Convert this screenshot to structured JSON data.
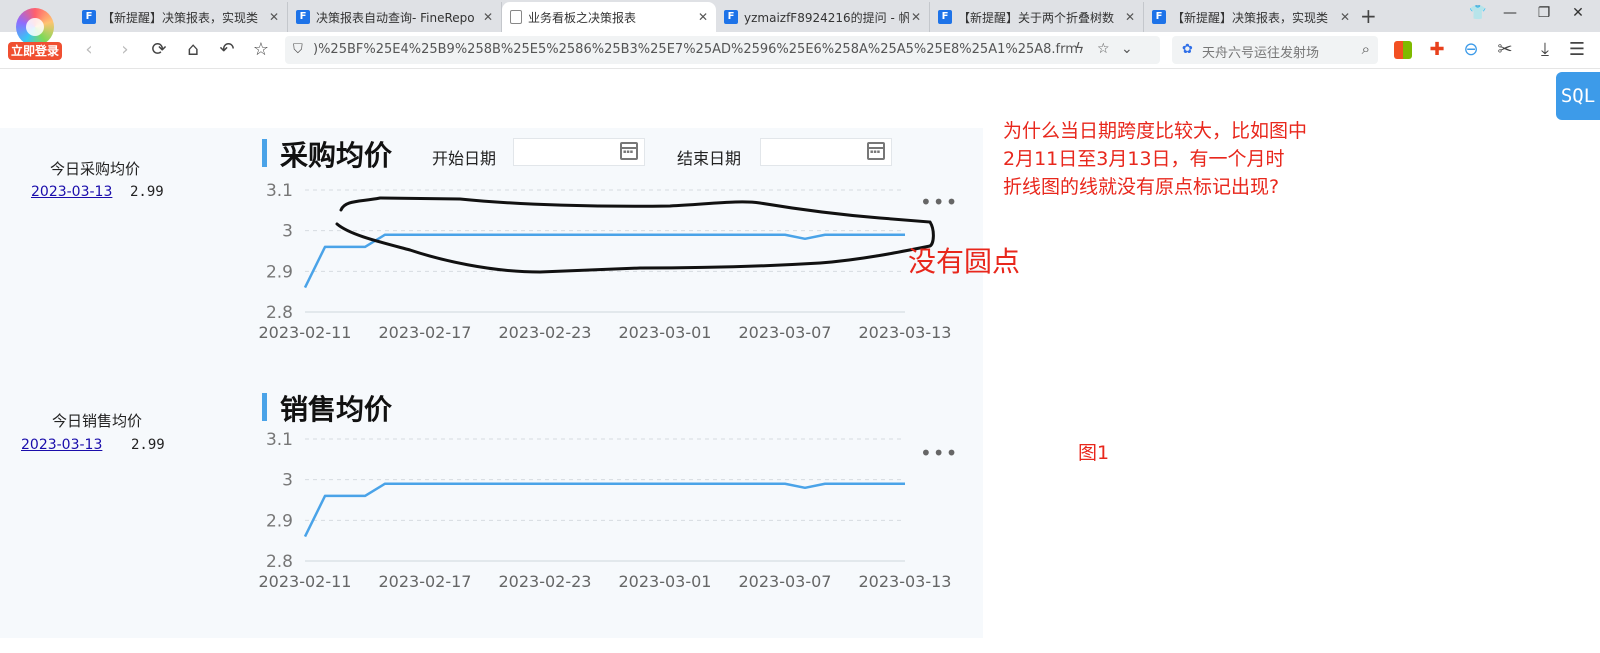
{
  "browser": {
    "login_label": "立即登录",
    "tabs": [
      {
        "title": "【新提醒】决策报表，实现类",
        "active": false
      },
      {
        "title": "决策报表自动查询- FineRepo",
        "active": false
      },
      {
        "title": "业务看板之决策报表",
        "active": true
      },
      {
        "title": "yzmaizfF8924216的提问 - 帆",
        "active": false
      },
      {
        "title": "【新提醒】关于两个折叠树数",
        "active": false
      },
      {
        "title": "【新提醒】决策报表，实现类",
        "active": false
      }
    ],
    "url": ")%25BF%25E4%25B9%258B%25E5%2586%25B3%25E7%25AD%2596%25E6%258A%25A5%25E8%25A1%25A8.frm",
    "search_placeholder": "天舟六号运往发射场"
  },
  "page": {
    "sql_button": "SQL",
    "purchase": {
      "side_title": "今日采购均价",
      "side_date": "2023-03-13",
      "side_value": "2.99",
      "title": "采购均价",
      "start_label": "开始日期",
      "end_label": "结束日期"
    },
    "sales": {
      "side_title": "今日销售均价",
      "side_date": "2023-03-13",
      "side_value": "2.99",
      "title": "销售均价"
    }
  },
  "annotations": {
    "question_lines": [
      "为什么当日期跨度比较大，比如图中",
      "2月11日至3月13日，有一个月时",
      "折线图的线就没有原点标记出现?"
    ],
    "no_dot": "没有圆点",
    "figure_label": "图1"
  },
  "colors": {
    "line": "#4aa3e8",
    "accent_bar": "#4aa3e8",
    "annotation": "#e8271c"
  },
  "chart_data": [
    {
      "type": "line",
      "x": [
        "2023-02-11",
        "2023-02-12",
        "2023-02-13",
        "2023-02-14",
        "2023-02-15",
        "2023-02-16",
        "2023-02-17",
        "2023-02-18",
        "2023-02-19",
        "2023-02-20",
        "2023-02-21",
        "2023-02-22",
        "2023-02-23",
        "2023-02-24",
        "2023-02-25",
        "2023-02-26",
        "2023-02-27",
        "2023-02-28",
        "2023-03-01",
        "2023-03-02",
        "2023-03-03",
        "2023-03-04",
        "2023-03-05",
        "2023-03-06",
        "2023-03-07",
        "2023-03-08",
        "2023-03-09",
        "2023-03-10",
        "2023-03-11",
        "2023-03-12",
        "2023-03-13"
      ],
      "series": [
        {
          "values": [
            2.86,
            2.96,
            2.96,
            2.96,
            2.99,
            2.99,
            2.99,
            2.99,
            2.99,
            2.99,
            2.99,
            2.99,
            2.99,
            2.99,
            2.99,
            2.99,
            2.99,
            2.99,
            2.99,
            2.99,
            2.99,
            2.99,
            2.99,
            2.99,
            2.99,
            2.98,
            2.99,
            2.99,
            2.99,
            2.99,
            2.99
          ]
        }
      ],
      "x_tick_labels": [
        "2023-02-11",
        "2023-02-17",
        "2023-02-23",
        "2023-03-01",
        "2023-03-07",
        "2023-03-13"
      ],
      "y_tick_labels": [
        "2.8",
        "2.9",
        "3",
        "3.1"
      ],
      "ylim": [
        2.8,
        3.1
      ],
      "grid": true
    },
    {
      "type": "line",
      "x": [
        "2023-02-11",
        "2023-02-12",
        "2023-02-13",
        "2023-02-14",
        "2023-02-15",
        "2023-02-16",
        "2023-02-17",
        "2023-02-18",
        "2023-02-19",
        "2023-02-20",
        "2023-02-21",
        "2023-02-22",
        "2023-02-23",
        "2023-02-24",
        "2023-02-25",
        "2023-02-26",
        "2023-02-27",
        "2023-02-28",
        "2023-03-01",
        "2023-03-02",
        "2023-03-03",
        "2023-03-04",
        "2023-03-05",
        "2023-03-06",
        "2023-03-07",
        "2023-03-08",
        "2023-03-09",
        "2023-03-10",
        "2023-03-11",
        "2023-03-12",
        "2023-03-13"
      ],
      "series": [
        {
          "values": [
            2.86,
            2.96,
            2.96,
            2.96,
            2.99,
            2.99,
            2.99,
            2.99,
            2.99,
            2.99,
            2.99,
            2.99,
            2.99,
            2.99,
            2.99,
            2.99,
            2.99,
            2.99,
            2.99,
            2.99,
            2.99,
            2.99,
            2.99,
            2.99,
            2.99,
            2.98,
            2.99,
            2.99,
            2.99,
            2.99,
            2.99
          ]
        }
      ],
      "x_tick_labels": [
        "2023-02-11",
        "2023-02-17",
        "2023-02-23",
        "2023-03-01",
        "2023-03-07",
        "2023-03-13"
      ],
      "y_tick_labels": [
        "2.8",
        "2.9",
        "3",
        "3.1"
      ],
      "ylim": [
        2.8,
        3.1
      ],
      "grid": true
    }
  ]
}
